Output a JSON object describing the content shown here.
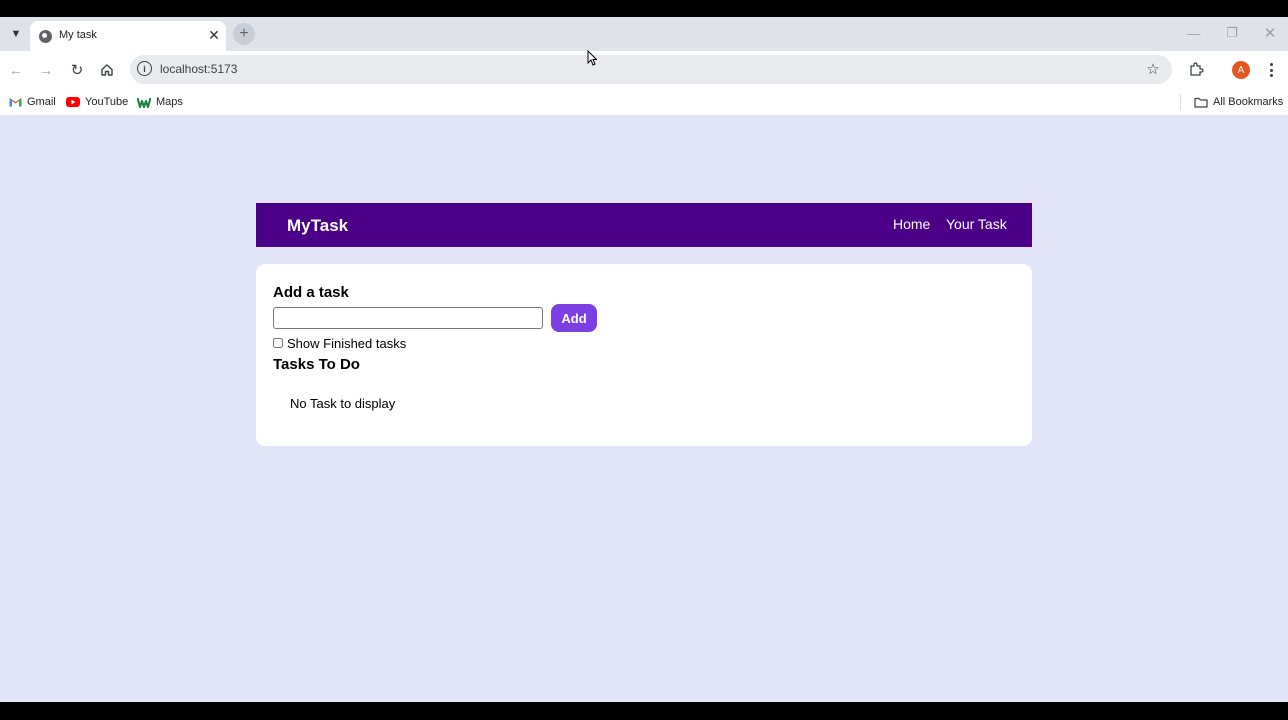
{
  "browser": {
    "tab": {
      "title": "My task"
    },
    "address_bar": {
      "url": "localhost:5173"
    },
    "bookmarks": [
      {
        "label": "Gmail"
      },
      {
        "label": "YouTube"
      },
      {
        "label": "Maps"
      }
    ],
    "all_bookmarks_label": "All Bookmarks",
    "profile_initial": "A"
  },
  "app": {
    "navbar": {
      "brand": "MyTask",
      "links": [
        "Home",
        "Your Task"
      ],
      "background": "#4c0087"
    },
    "form": {
      "heading": "Add a task",
      "input_value": "",
      "add_button_label": "Add",
      "accent": "#7b3fe4"
    },
    "filter": {
      "label": "Show Finished tasks",
      "checked": false
    },
    "list": {
      "heading": "Tasks To Do",
      "empty_message": "No Task to display"
    },
    "page_background": "#e2e5f9"
  }
}
